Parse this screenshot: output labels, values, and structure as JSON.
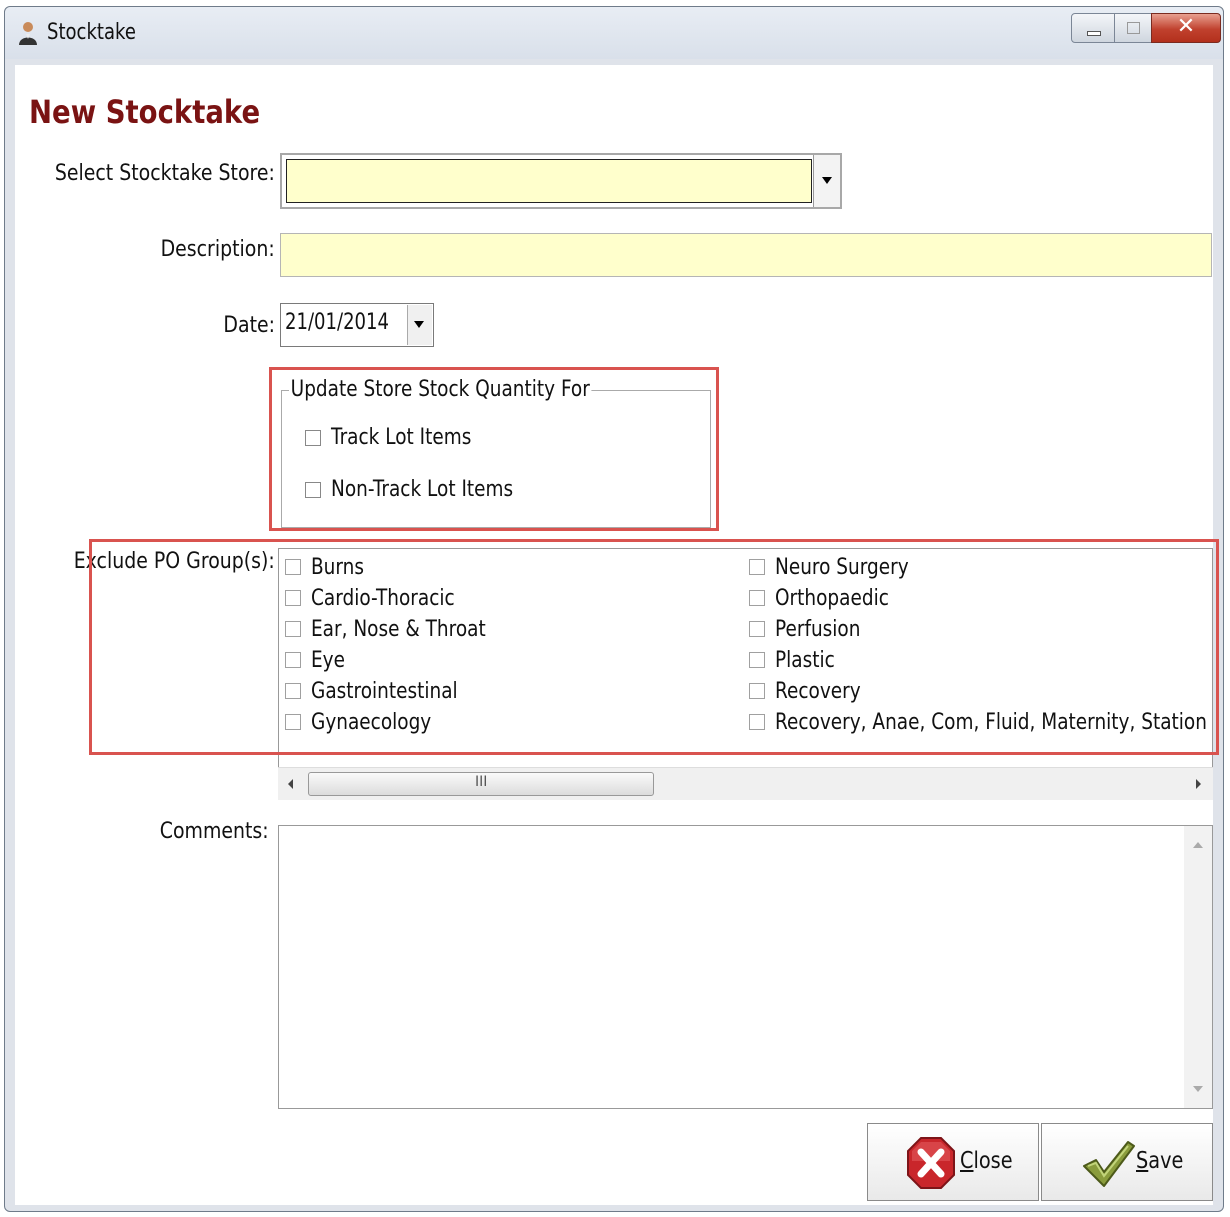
{
  "window": {
    "title": "Stocktake"
  },
  "form": {
    "heading": "New Stocktake",
    "store_label": "Select Stocktake Store:",
    "store_value": "",
    "description_label": "Description:",
    "description_value": "",
    "date_label": "Date:",
    "date_value": "21/01/2014"
  },
  "update_group": {
    "title": "Update Store Stock Quantity For",
    "options": [
      {
        "label": "Track Lot Items",
        "checked": false
      },
      {
        "label": "Non-Track Lot Items",
        "checked": false
      }
    ]
  },
  "exclude_groups": {
    "label": "Exclude PO Group(s):",
    "items": [
      {
        "label": "Burns",
        "checked": false
      },
      {
        "label": "Cardio-Thoracic",
        "checked": false
      },
      {
        "label": "Ear, Nose & Throat",
        "checked": false
      },
      {
        "label": "Eye",
        "checked": false
      },
      {
        "label": "Gastrointestinal",
        "checked": false
      },
      {
        "label": "Gynaecology",
        "checked": false
      },
      {
        "label": "Neuro Surgery",
        "checked": false
      },
      {
        "label": "Orthopaedic",
        "checked": false
      },
      {
        "label": "Perfusion",
        "checked": false
      },
      {
        "label": "Plastic",
        "checked": false
      },
      {
        "label": "Recovery",
        "checked": false
      },
      {
        "label": "Recovery, Anae, Com, Fluid, Maternity, Station",
        "checked": false
      }
    ],
    "scroll_grip": "III"
  },
  "comments": {
    "label": "Comments:",
    "value": ""
  },
  "buttons": {
    "close_accel": "C",
    "close_rest": "lose",
    "save_accel": "S",
    "save_rest": "ave"
  },
  "colors": {
    "heading": "#7a1313",
    "required_field": "#ffffcc",
    "highlight_box": "#d9534f"
  }
}
